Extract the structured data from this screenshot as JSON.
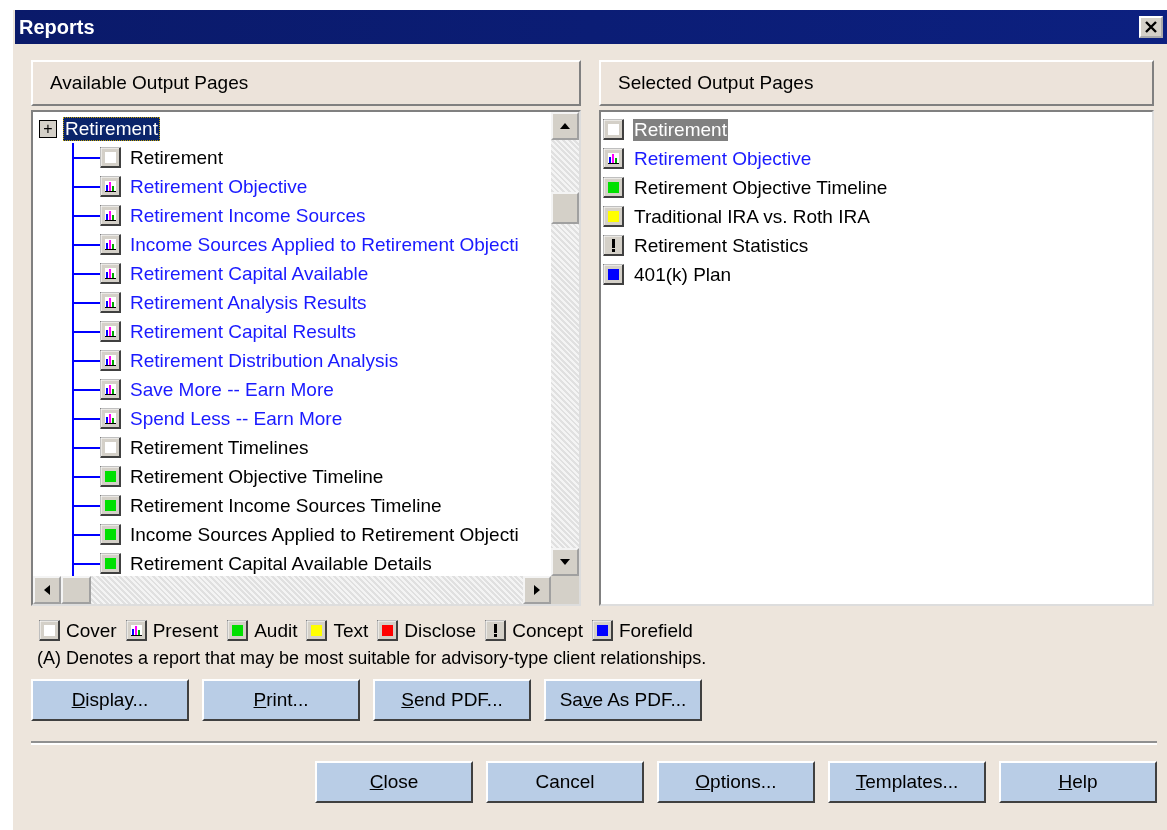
{
  "window": {
    "title": "Reports"
  },
  "available": {
    "header": "Available Output Pages",
    "tree": {
      "toggle": "+",
      "label": "Retirement",
      "selected": true,
      "children": [
        {
          "label": "Retirement",
          "kind": "cover",
          "selected": false
        },
        {
          "label": "Retirement Objective",
          "kind": "present",
          "selected": false
        },
        {
          "label": "Retirement Income Sources",
          "kind": "present",
          "selected": false
        },
        {
          "label": "Income Sources Applied to Retirement Objecti",
          "kind": "present",
          "selected": false
        },
        {
          "label": "Retirement Capital Available",
          "kind": "present",
          "selected": false
        },
        {
          "label": "Retirement Analysis Results",
          "kind": "present",
          "selected": false
        },
        {
          "label": "Retirement Capital Results",
          "kind": "present",
          "selected": false
        },
        {
          "label": "Retirement Distribution Analysis",
          "kind": "present",
          "selected": false
        },
        {
          "label": "Save More -- Earn More",
          "kind": "present",
          "selected": false
        },
        {
          "label": "Spend Less -- Earn More",
          "kind": "present",
          "selected": false
        },
        {
          "label": "Retirement Timelines",
          "kind": "cover",
          "selected": false
        },
        {
          "label": "Retirement Objective Timeline",
          "kind": "audit",
          "selected": false
        },
        {
          "label": "Retirement Income Sources Timeline",
          "kind": "audit",
          "selected": false
        },
        {
          "label": "Income Sources Applied to Retirement Objecti",
          "kind": "audit",
          "selected": false
        },
        {
          "label": "Retirement Capital Available Details",
          "kind": "audit",
          "selected": false
        }
      ]
    }
  },
  "selected_pages": {
    "header": "Selected Output Pages",
    "items": [
      {
        "label": "Retirement",
        "kind": "cover",
        "selected": true
      },
      {
        "label": "Retirement Objective",
        "kind": "present",
        "selected": false
      },
      {
        "label": "Retirement Objective Timeline",
        "kind": "audit",
        "selected": false
      },
      {
        "label": "Traditional IRA vs. Roth IRA",
        "kind": "text",
        "selected": false
      },
      {
        "label": "Retirement Statistics",
        "kind": "concept",
        "selected": false
      },
      {
        "label": "401(k) Plan",
        "kind": "forefield",
        "selected": false
      }
    ]
  },
  "legend": [
    {
      "kind": "cover",
      "label": "Cover"
    },
    {
      "kind": "present",
      "label": "Present"
    },
    {
      "kind": "audit",
      "label": "Audit"
    },
    {
      "kind": "text",
      "label": "Text"
    },
    {
      "kind": "disclose",
      "label": "Disclose"
    },
    {
      "kind": "concept",
      "label": "Concept"
    },
    {
      "kind": "forefield",
      "label": "Forefield"
    }
  ],
  "note": "(A) Denotes a report that may be most suitable for advisory-type client relationships.",
  "action_buttons": [
    {
      "key": "D",
      "after": "isplay..."
    },
    {
      "key": "P",
      "after": "rint..."
    },
    {
      "key": "S",
      "after": "end PDF..."
    },
    {
      "before": "Sa",
      "key": "v",
      "after": "e As PDF..."
    }
  ],
  "dialog_buttons": [
    {
      "key": "C",
      "after": "lose"
    },
    {
      "before": "Cancel"
    },
    {
      "key": "O",
      "after": "ptions..."
    },
    {
      "key": "T",
      "after": "emplates..."
    },
    {
      "key": "H",
      "after": "elp"
    }
  ]
}
